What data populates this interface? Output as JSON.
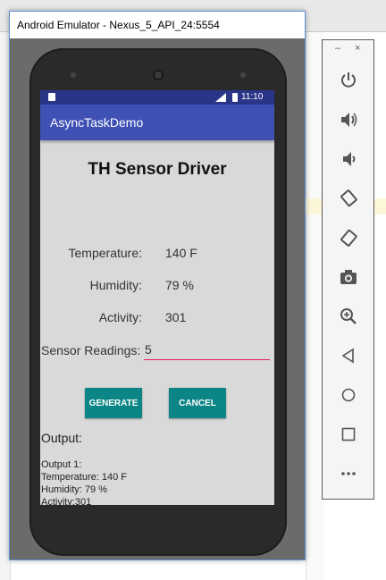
{
  "window": {
    "title": "Android Emulator - Nexus_5_API_24:5554"
  },
  "statusbar": {
    "time": "11:10"
  },
  "app": {
    "title": "AsyncTaskDemo",
    "heading": "TH Sensor Driver",
    "fields": [
      {
        "label": "Temperature:",
        "value": "140 F"
      },
      {
        "label": "Humidity:",
        "value": "79 %"
      },
      {
        "label": "Activity:",
        "value": "301"
      }
    ],
    "sensor_readings": {
      "label": "Sensor Readings:",
      "value": "5"
    },
    "buttons": {
      "generate": "GENERATE",
      "cancel": "CANCEL"
    },
    "output": {
      "title": "Output:",
      "lines": [
        "Output 1:",
        "Temperature: 140 F",
        "Humidity: 79 %",
        "Activity:301"
      ]
    }
  },
  "side_toolbar": {
    "minimize": "–",
    "close": "×",
    "tools": [
      "power-icon",
      "volume-up-icon",
      "volume-down-icon",
      "rotate-left-icon",
      "rotate-right-icon",
      "camera-icon",
      "zoom-icon",
      "back-icon",
      "home-icon",
      "overview-icon",
      "more-icon"
    ]
  },
  "colors": {
    "appbar": "#3f51b5",
    "statusbar": "#2b3588",
    "button": "#0b8585",
    "input_underline": "#e91e63",
    "screen_bg": "#d9d9d9"
  }
}
